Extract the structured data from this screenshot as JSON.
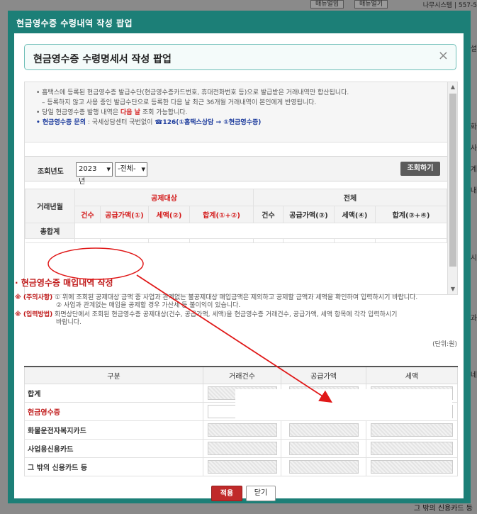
{
  "background": {
    "top_buttons": [
      "매뉴얼임",
      "매뉴얼기"
    ],
    "top_right_text": "나무시스템 | 557-5",
    "side_texts": [
      "설",
      "화",
      "사",
      "계",
      "내",
      "시",
      "과",
      "네"
    ],
    "bottom_text": "그 밖의 신용카드 등"
  },
  "popup": {
    "window_title": "현금영수증 수령내역 작성 팝업",
    "header_title": "현금영수증 수령명세서 작성 팝업",
    "close_glyph": "×"
  },
  "notice": {
    "line1": "• 홈택스에 등록된 현금영수증 발급수단(현금영수증카드번호, 휴대전화번호 등)으로 발급받은 거래내역만 합산됩니다.",
    "line2": "– 등록하지 않고 사용 중인 발급수단으로 등록한 다음 날 최근 36개월 거래내역이 본인에게 반영됩니다.",
    "line3_pre": "• 당일 현금영수증 발행 내역은 ",
    "line3_red": "다음 날",
    "line3_post": " 조회 가능합니다.",
    "line4_blue": "• 현금영수증 문의",
    "line4_mid": " : 국세상담센터 국번없이 ",
    "line4_blue2": "☎126(①홈택스상담 → ①현금영수증)"
  },
  "search": {
    "label": "조회년도",
    "year": "2023년",
    "type": "-전체-",
    "button": "조회하기"
  },
  "summary_table": {
    "col_deal": "거래년월",
    "group_deduct": "공제대상",
    "group_total": "전체",
    "deduct_cols": [
      "건수",
      "공급가액(①)",
      "세액(②)",
      "합계(①+②)"
    ],
    "total_cols": [
      "건수",
      "공급가액(③)",
      "세액(④)",
      "합계(③+④)"
    ],
    "row_total": "총합계"
  },
  "entry": {
    "title": "· 현금영수증 매입내역 작성",
    "caution_tag": "※ (주의사항)",
    "caution_1": " ① 위에 조회된 공제대상 금액 중 사업과 관계없는 불공제대상 매입금액은 제외하고 공제할 금액과 세액을 확인하여 입력하시기 바랍니다.",
    "caution_2": "② 사업과 관계없는 매입을 공제할 경우 가산세 등 불이익이 있습니다.",
    "input_tag": "※ (입력방법)",
    "input_1": " 화면상단에서 조회된 현금영수증 공제대상(건수, 공급가액, 세액)을 현금영수증 거래건수, 공급가액, 세액 항목에 각각 입력하시기",
    "input_2": "바랍니다.",
    "unit": "(단위:원)",
    "headers": [
      "구분",
      "거래건수",
      "공급가액",
      "세액"
    ],
    "rows": [
      {
        "label": "합계",
        "red": false
      },
      {
        "label": "현금영수증",
        "red": true
      },
      {
        "label": "화물운전자복지카드",
        "red": false
      },
      {
        "label": "사업용신용카드",
        "red": false
      },
      {
        "label": "그 밖의 신용카드 등",
        "red": false
      }
    ]
  },
  "buttons": {
    "apply": "적용",
    "close": "닫기"
  },
  "colors": {
    "popup_frame": "#1c7f77",
    "accent_red": "#c01a1a",
    "annotation_red": "#e01818"
  }
}
